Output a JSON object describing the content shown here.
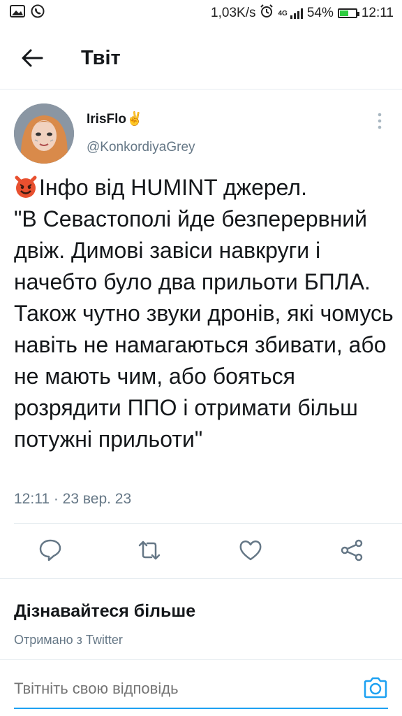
{
  "status_bar": {
    "speed": "1,03K/s",
    "network": "4G",
    "battery": "54%",
    "battery_level": 0.54,
    "time": "12:11",
    "icons": [
      "image-icon",
      "viber-icon",
      "alarm-icon",
      "signal-icon",
      "battery-icon"
    ]
  },
  "header": {
    "title": "Твіт",
    "back_icon": "back-arrow-icon"
  },
  "tweet": {
    "display_name": "IrisFlo",
    "name_emoji": "✌",
    "handle": "@KonkordiyaGrey",
    "text_emoji": "smiling-devil-emoji",
    "text": "Інфо від HUMINT джерел.\n\"В Севастополі йде безперервний двіж. Димові завіси навкруги і начебто було два прильоти БПЛА. Також чутно звуки дронів, які чомусь навіть не намагаються збивати, або не мають чим, або бояться розрядити ППО і отримати більш потужні прильоти\"",
    "timestamp": "12:11 · 23 вер. 23"
  },
  "actions": [
    "reply-icon",
    "retweet-icon",
    "like-icon",
    "share-icon"
  ],
  "learn_more": {
    "title": "Дізнавайтеся більше",
    "source": "Отримано з Twitter"
  },
  "reply": {
    "placeholder": "Твітніть свою відповідь"
  },
  "colors": {
    "accent": "#1da1f2",
    "secondary_text": "#657786",
    "divider": "#e6ecf0"
  }
}
